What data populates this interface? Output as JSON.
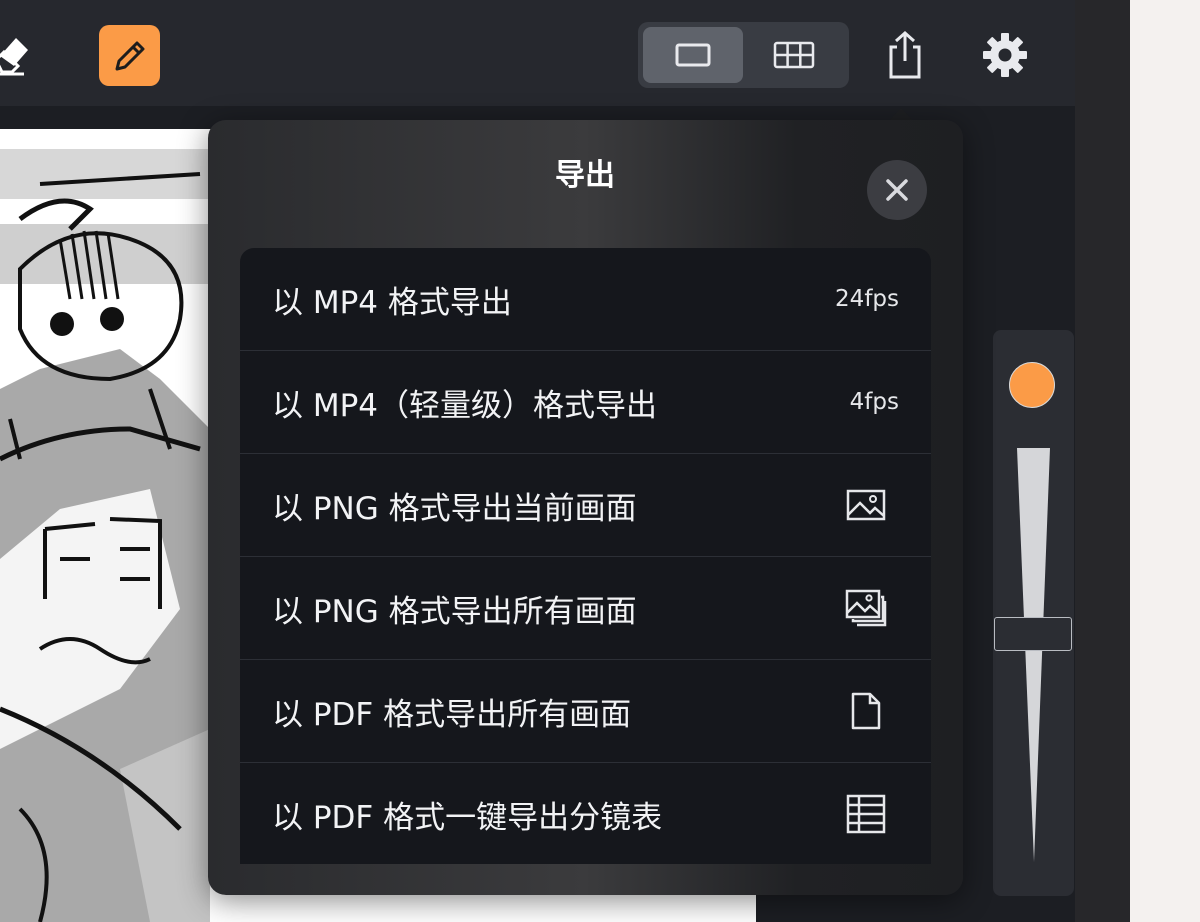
{
  "toolbar": {
    "eraser_icon": "eraser-icon",
    "pencil_icon": "pencil-icon",
    "view_single_icon": "single-frame-icon",
    "view_grid_icon": "grid-view-icon",
    "share_icon": "share-icon",
    "settings_icon": "gear-icon",
    "accent": "#fb9b47"
  },
  "export_popover": {
    "title": "导出",
    "close_icon": "close-icon",
    "items": [
      {
        "label": "以 MP4 格式导出",
        "detail": "24fps"
      },
      {
        "label": "以 MP4（轻量级）格式导出",
        "detail": "4fps"
      },
      {
        "label": "以 PNG 格式导出当前画面",
        "icon": "image-icon"
      },
      {
        "label": "以 PNG 格式导出所有画面",
        "icon": "images-stack-icon"
      },
      {
        "label": "以 PDF 格式导出所有画面",
        "icon": "document-icon"
      },
      {
        "label": "以 PDF 格式一键导出分镜表",
        "icon": "table-icon"
      }
    ]
  },
  "brush_panel": {
    "color": "#fb9b47",
    "size_level": 0.55
  }
}
